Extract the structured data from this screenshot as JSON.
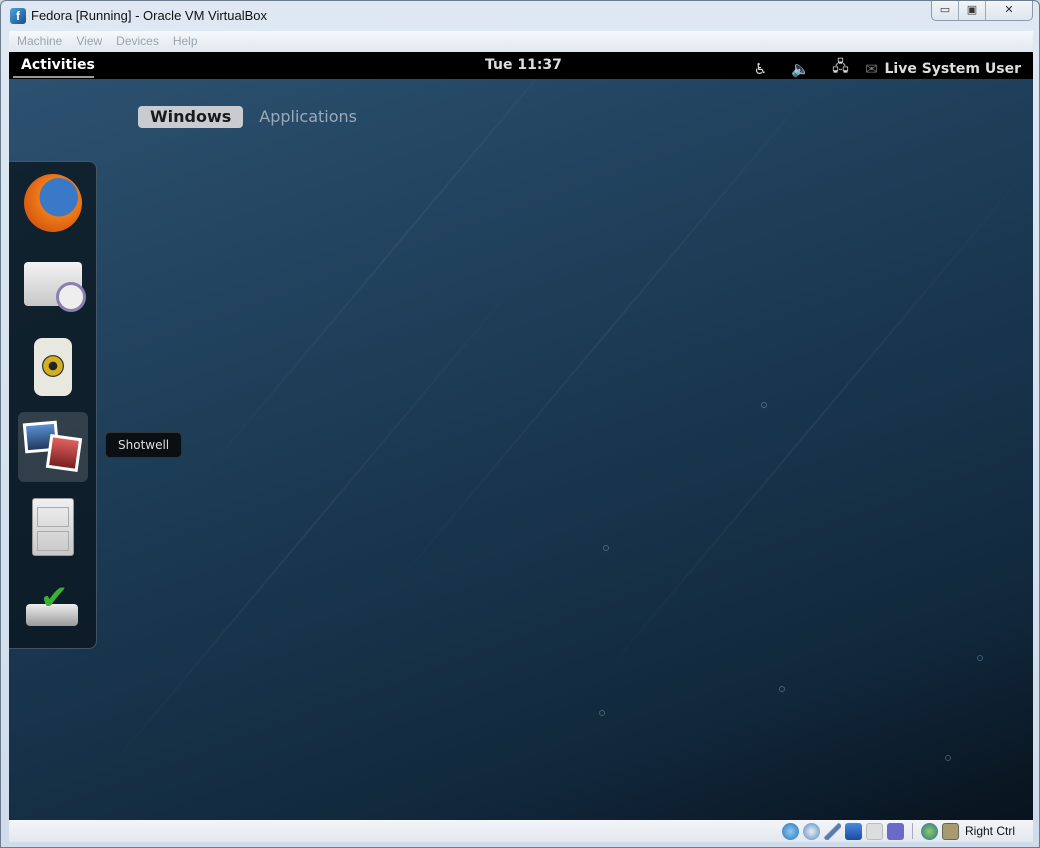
{
  "window": {
    "title": "Fedora [Running] - Oracle VM VirtualBox",
    "minimize": "▭",
    "maximize": "▣",
    "close": "✕"
  },
  "menubar": [
    "Machine",
    "View",
    "Devices",
    "Help"
  ],
  "topbar": {
    "activities": "Activities",
    "clock": "Tue 11:37",
    "user": "Live System User",
    "icons": [
      "accessibility-icon",
      "volume-icon",
      "network-icon",
      "chat-offline-icon"
    ]
  },
  "overview": {
    "tabs": [
      {
        "label": "Windows",
        "active": true
      },
      {
        "label": "Applications",
        "active": false
      }
    ]
  },
  "dash": {
    "items": [
      "Firefox",
      "Evolution",
      "Rhythmbox",
      "Shotwell",
      "Files",
      "Install to Hard Drive"
    ],
    "tooltip": "Shotwell"
  },
  "statusbar": {
    "host_key": "Right Ctrl"
  }
}
